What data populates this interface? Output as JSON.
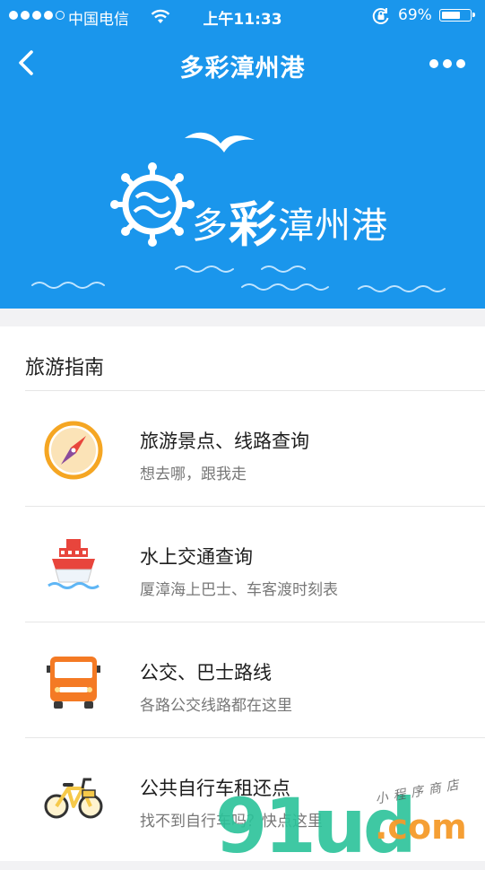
{
  "status_bar": {
    "carrier": "中国电信",
    "time": "上午11:33",
    "battery_percent": "69%",
    "battery_level": 0.69
  },
  "navbar": {
    "title": "多彩漳州港",
    "back_icon": "chevron-left-icon",
    "more_icon": "more-dots-icon"
  },
  "banner": {
    "brand_prefix": "多",
    "brand_emphasis": "彩",
    "brand_suffix": "漳州港",
    "logo_icon": "ship-wheel-icon"
  },
  "section": {
    "title": "旅游指南",
    "items": [
      {
        "title": "旅游景点、线路查询",
        "subtitle": "想去哪，跟我走",
        "icon": "compass-icon"
      },
      {
        "title": "水上交通查询",
        "subtitle": "厦漳海上巴士、车客渡时刻表",
        "icon": "ship-icon"
      },
      {
        "title": "公交、巴士路线",
        "subtitle": "各路公交线路都在这里",
        "icon": "bus-icon"
      },
      {
        "title": "公共自行车租还点",
        "subtitle": "找不到自行车吗？快点这里",
        "icon": "bicycle-icon"
      }
    ]
  },
  "watermark": {
    "main": "91ud",
    "domain": ".com",
    "tagline": "小程序商店"
  },
  "colors": {
    "primary_blue": "#1a96ec",
    "compass_ring": "#f5a623",
    "ship_red": "#e8453c",
    "bus_orange": "#f47a24",
    "bike_yellow": "#f6c94a"
  }
}
